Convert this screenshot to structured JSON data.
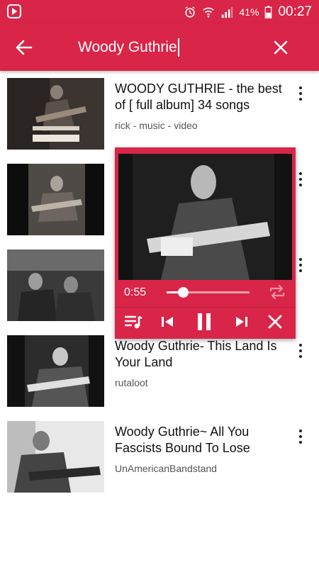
{
  "status_bar": {
    "battery_percent": "41%",
    "time": "00:27",
    "icons": [
      "app-badge-icon",
      "alarm-icon",
      "wifi-icon",
      "signal-icon",
      "battery-icon"
    ]
  },
  "search_bar": {
    "query": "Woody Guthrie",
    "back_icon": "arrow-left-icon",
    "clear_icon": "close-icon"
  },
  "results": [
    {
      "title": "WOODY GUTHRIE - the best of [ full album] 34 songs",
      "channel": "rick - music - video"
    },
    {
      "title": "",
      "channel": ""
    },
    {
      "title": "",
      "channel": ""
    },
    {
      "title": "Woody Guthrie- This Land Is Your Land",
      "channel": "rutaloot"
    },
    {
      "title": "Woody Guthrie~ All You Fascists Bound To Lose",
      "channel": "UnAmericanBandstand"
    }
  ],
  "player": {
    "elapsed": "0:55",
    "progress": 0.2,
    "controls": [
      "queue-icon",
      "previous-icon",
      "pause-icon",
      "next-icon",
      "close-icon"
    ],
    "repeat_icon": "repeat-icon"
  },
  "colors": {
    "accent": "#d92548",
    "text": "#111111",
    "subtext": "#555555"
  }
}
